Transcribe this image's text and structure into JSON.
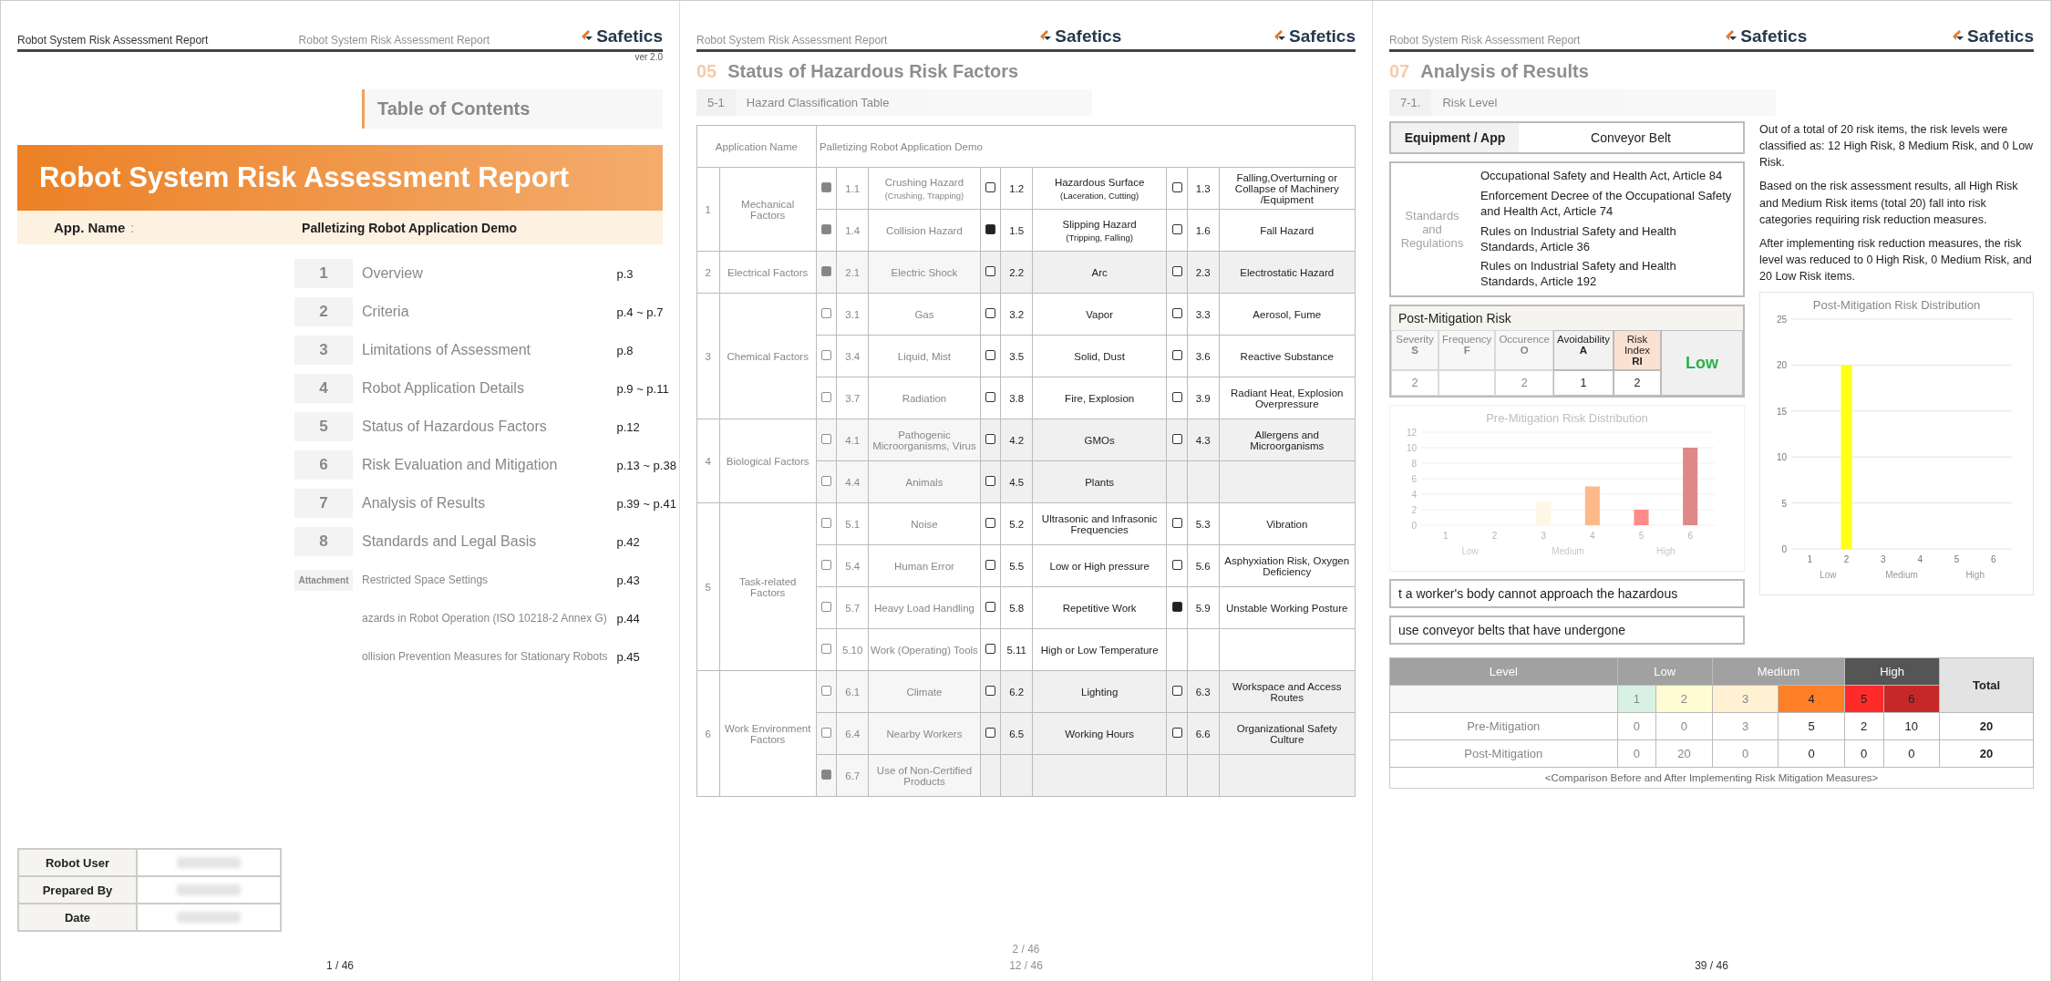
{
  "cover": {
    "header": "Robot System Risk Assessment Report",
    "title": "Robot System Risk Assessment Report",
    "app_label": "App. Name",
    "app_sep": ":",
    "app_value": "Palletizing Robot Application Demo",
    "info_rows": [
      {
        "label": "Robot User"
      },
      {
        "label": "Prepared By"
      },
      {
        "label": "Date"
      }
    ],
    "page": "1 / 46"
  },
  "toc": {
    "header": "Robot System Risk Assessment Report",
    "logo": "Safetics",
    "version": "ver 2.0",
    "title": "Table of Contents",
    "items": [
      {
        "kind": "section",
        "number": "1",
        "label": "Overview",
        "page": "p.3"
      },
      {
        "kind": "section",
        "number": "2",
        "label": "Criteria",
        "page": "p.4 ~ p.7"
      },
      {
        "kind": "section",
        "number": "3",
        "label": "Limitations of Assessment",
        "page": "p.8"
      },
      {
        "kind": "section",
        "number": "4",
        "label": "Robot Application Details",
        "page": "p.9 ~ p.11"
      },
      {
        "kind": "section",
        "number": "5",
        "label": "Status of Hazardous Factors",
        "page": "p.12"
      },
      {
        "kind": "section",
        "number": "6",
        "label": "Risk Evaluation and Mitigation",
        "page": "p.13 ~ p.38"
      },
      {
        "kind": "section",
        "number": "7",
        "label": "Analysis of Results",
        "page": "p.39 ~ p.41"
      },
      {
        "kind": "section",
        "number": "8",
        "label": "Standards and Legal Basis",
        "page": "p.42"
      },
      {
        "kind": "attachment",
        "number": "Attachment",
        "label": "Restricted Space Settings",
        "page": "p.43"
      },
      {
        "kind": "attachment",
        "label": "azards in Robot Operation (ISO 10218-2 Annex G)",
        "page": "p.44"
      },
      {
        "kind": "attachment",
        "label": "ollision Prevention Measures for Stationary Robots",
        "page": "p.45"
      }
    ],
    "page": "2 / 46"
  },
  "hazards": {
    "header": "Robot System Risk Assessment Report",
    "logos": [
      "Safetics",
      "Safetics"
    ],
    "section_number": "05",
    "section_title": "Status of Hazardous Risk Factors",
    "sub_number": "5-1",
    "sub_title": "Hazard Classification Table",
    "app_label": "Application Name",
    "app_value": "Palletizing Robot Application Demo",
    "categories": [
      {
        "number": "1",
        "name": "Mechanical Factors",
        "rows": [
          [
            {
              "number": "1.1",
              "name": "Crushing Hazard",
              "note": "(Crushing, Trapping)",
              "checked": true
            },
            {
              "number": "1.2",
              "name": "Hazardous Surface",
              "note": "(Laceration, Cutting)",
              "checked": false
            },
            {
              "number": "1.3",
              "name": "Falling,Overturning or Collapse of Machinery /Equipment",
              "checked": false
            }
          ],
          [
            {
              "number": "1.4",
              "name": "Collision Hazard",
              "checked": true
            },
            {
              "number": "1.5",
              "name": "Slipping Hazard",
              "note": "(Tripping, Falling)",
              "checked": true
            },
            {
              "number": "1.6",
              "name": "Fall Hazard",
              "checked": false
            }
          ]
        ]
      },
      {
        "number": "2",
        "name": "Electrical Factors",
        "rows": [
          [
            {
              "number": "2.1",
              "name": "Electric Shock",
              "checked": true
            },
            {
              "number": "2.2",
              "name": "Arc",
              "checked": false
            },
            {
              "number": "2.3",
              "name": "Electrostatic Hazard",
              "checked": false
            }
          ]
        ]
      },
      {
        "number": "3",
        "name": "Chemical Factors",
        "rows": [
          [
            {
              "number": "3.1",
              "name": "Gas",
              "checked": false
            },
            {
              "number": "3.2",
              "name": "Vapor",
              "checked": false
            },
            {
              "number": "3.3",
              "name": "Aerosol, Fume",
              "checked": false
            }
          ],
          [
            {
              "number": "3.4",
              "name": "Liquid, Mist",
              "checked": false
            },
            {
              "number": "3.5",
              "name": "Solid, Dust",
              "checked": false
            },
            {
              "number": "3.6",
              "name": "Reactive Substance",
              "checked": false
            }
          ],
          [
            {
              "number": "3.7",
              "name": "Radiation",
              "checked": false
            },
            {
              "number": "3.8",
              "name": "Fire, Explosion",
              "checked": false
            },
            {
              "number": "3.9",
              "name": "Radiant Heat, Explosion Overpressure",
              "checked": false
            }
          ]
        ]
      },
      {
        "number": "4",
        "name": "Biological Factors",
        "rows": [
          [
            {
              "number": "4.1",
              "name": "Pathogenic Microorganisms, Virus",
              "checked": false
            },
            {
              "number": "4.2",
              "name": "GMOs",
              "checked": false
            },
            {
              "number": "4.3",
              "name": "Allergens and Microorganisms",
              "checked": false
            }
          ],
          [
            {
              "number": "4.4",
              "name": "Animals",
              "checked": false
            },
            {
              "number": "4.5",
              "name": "Plants",
              "checked": false
            },
            null
          ]
        ]
      },
      {
        "number": "5",
        "name": "Task-related Factors",
        "rows": [
          [
            {
              "number": "5.1",
              "name": "Noise",
              "checked": false
            },
            {
              "number": "5.2",
              "name": "Ultrasonic and Infrasonic Frequencies",
              "checked": false
            },
            {
              "number": "5.3",
              "name": "Vibration",
              "checked": false
            }
          ],
          [
            {
              "number": "5.4",
              "name": "Human Error",
              "checked": false
            },
            {
              "number": "5.5",
              "name": "Low or High pressure",
              "checked": false
            },
            {
              "number": "5.6",
              "name": "Asphyxiation Risk, Oxygen Deficiency",
              "checked": false
            }
          ],
          [
            {
              "number": "5.7",
              "name": "Heavy Load Handling",
              "checked": false
            },
            {
              "number": "5.8",
              "name": "Repetitive Work",
              "checked": false
            },
            {
              "number": "5.9",
              "name": "Unstable Working Posture",
              "checked": true
            }
          ],
          [
            {
              "number": "5.10",
              "name": "Work (Operating) Tools",
              "checked": false
            },
            {
              "number": "5.11",
              "name": "High or Low Temperature",
              "checked": false
            },
            null
          ]
        ]
      },
      {
        "number": "6",
        "name": "Work Environment Factors",
        "rows": [
          [
            {
              "number": "6.1",
              "name": "Climate",
              "checked": false
            },
            {
              "number": "6.2",
              "name": "Lighting",
              "checked": false
            },
            {
              "number": "6.3",
              "name": "Workspace and Access Routes",
              "checked": false
            }
          ],
          [
            {
              "number": "6.4",
              "name": "Nearby Workers",
              "checked": false
            },
            {
              "number": "6.5",
              "name": "Working Hours",
              "checked": false
            },
            {
              "number": "6.6",
              "name": "Organizational Safety Culture",
              "checked": false
            }
          ],
          [
            {
              "number": "6.7",
              "name": "Use of Non-Certified Products",
              "checked": true
            },
            null,
            null
          ]
        ]
      }
    ],
    "page": "12 / 46"
  },
  "analysis": {
    "header": "Robot System Risk Assessment Report",
    "logos": [
      "Safetics",
      "Safetics"
    ],
    "section_number": "07",
    "section_title": "Analysis of Results",
    "sub_number": "7-1.",
    "sub_title": "Risk Level",
    "equipment_label": "Equipment / App",
    "equipment_value": "Conveyor Belt",
    "standards_label": "Standards and Regulations",
    "standards": [
      "Occupational Safety and Health Act, Article 84",
      "Enforcement Decree of the Occupational Safety and Health Act, Article 74",
      "Rules on Industrial Safety and Health Standards, Article 36",
      "Rules on Industrial Safety and Health Standards, Article 192"
    ],
    "post_risk": {
      "title": "Post-Mitigation Risk",
      "columns": [
        {
          "name": "Severity",
          "symbol": "S",
          "value": "2"
        },
        {
          "name": "Frequency",
          "symbol": "F"
        },
        {
          "name": "Occurence",
          "symbol": "O",
          "value": "2"
        },
        {
          "name": "Avoidability",
          "symbol": "A",
          "value": "1"
        },
        {
          "name": "Risk Index",
          "symbol": "RI",
          "value": "2"
        }
      ],
      "result": "Low"
    },
    "pre_chart": {
      "chart_data": {
        "type": "bar",
        "title": "Pre-Mitigation Risk Distribution",
        "categories": [
          "1",
          "2",
          "3",
          "4",
          "5",
          "6"
        ],
        "values": [
          0,
          0,
          3,
          5,
          2,
          10
        ],
        "grid": true,
        "ylim": [
          0,
          12
        ],
        "yticks": [
          0,
          2,
          4,
          6,
          8,
          10,
          12
        ]
      },
      "group_labels": [
        "Low",
        "Medium",
        "High"
      ]
    },
    "notes": [
      "t a worker's body cannot approach the hazardous",
      "use conveyor belts that have undergone"
    ],
    "summary": [
      "Out of a total of 20 risk items, the risk levels were classified as: 12 High Risk, 8 Medium Risk, and 0 Low Risk.",
      "Based on the risk assessment results, all High Risk and Medium Risk items (total 20) fall into risk categories requiring risk reduction measures.",
      "After implementing risk reduction measures, the risk level was reduced to 0 High Risk, 0 Medium Risk, and 20 Low Risk items."
    ],
    "post_chart": {
      "chart_data": {
        "type": "bar",
        "title": "Post-Mitigation Risk Distribution",
        "categories": [
          "1",
          "2",
          "3",
          "4",
          "5",
          "6"
        ],
        "values": [
          0,
          20,
          0,
          0,
          0,
          0
        ],
        "grid": true,
        "ylim": [
          0,
          25
        ],
        "yticks": [
          0,
          5,
          10,
          15,
          20,
          25
        ]
      },
      "group_labels": [
        "Low",
        "Medium",
        "High"
      ]
    },
    "risk_table": {
      "level_label": "Level",
      "total_label": "Total",
      "groups": [
        "Low",
        "Medium",
        "High"
      ],
      "levels": [
        {
          "label": "1",
          "color": "#d8f1e4"
        },
        {
          "label": "2",
          "color": "#fffbd2"
        },
        {
          "label": "3",
          "color": "#fff1d2"
        },
        {
          "label": "4",
          "color": "#ff7f27"
        },
        {
          "label": "5",
          "color": "#ff2b2b"
        },
        {
          "label": "6",
          "color": "#c62828"
        }
      ],
      "rows": [
        {
          "label": "Pre-Mitigation",
          "values": [
            "0",
            "0",
            "3",
            "5",
            "2",
            "10"
          ],
          "total": "20"
        },
        {
          "label": "Post-Mitigation",
          "values": [
            "0",
            "20",
            "0",
            "0",
            "0",
            "0"
          ],
          "total": "20"
        }
      ],
      "caption": "<Comparison Before and After Implementing Risk Mitigation Measures>"
    },
    "page": "39 / 46"
  }
}
